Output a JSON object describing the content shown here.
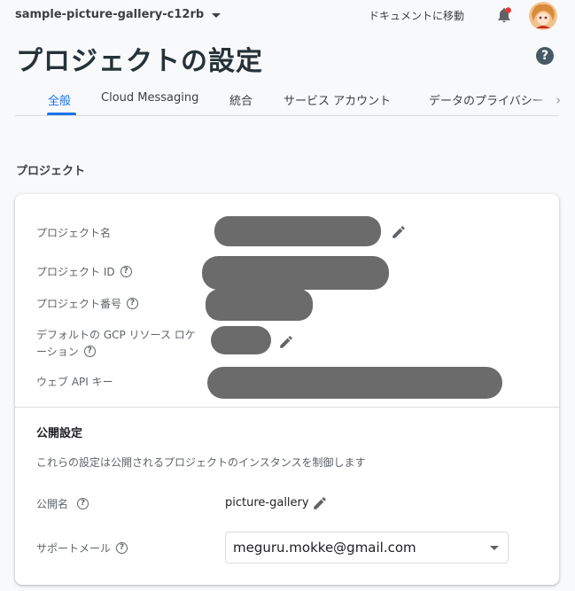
{
  "header": {
    "project_name": "sample-picture-gallery-c12rb",
    "docs_link": "ドキュメントに移動"
  },
  "page": {
    "title": "プロジェクトの設定"
  },
  "tabs": [
    {
      "label": "全般",
      "active": true
    },
    {
      "label": "Cloud Messaging",
      "active": false
    },
    {
      "label": "統合",
      "active": false
    },
    {
      "label": "サービス アカウント",
      "active": false
    },
    {
      "label": "データのプライバシー",
      "active": false
    }
  ],
  "project_section": {
    "label": "プロジェクト",
    "fields": {
      "name": "プロジェクト名",
      "id": "プロジェクト ID",
      "number": "プロジェクト番号",
      "location_line1": "デフォルトの GCP リソース ロケ",
      "location_line2": "ーション",
      "api_key": "ウェブ API キー"
    }
  },
  "public_settings": {
    "title": "公開設定",
    "description": "これらの設定は公開されるプロジェクトのインスタンスを制御します",
    "public_name_label": "公開名",
    "public_name_value": "picture-gallery",
    "support_email_label": "サポートメール",
    "support_email_value": "meguru.mokke@gmail.com"
  },
  "colors": {
    "accent": "#1a73e8",
    "redaction": "#6b6b6b",
    "notification_dot": "#e53935"
  },
  "icons": {
    "help": "?",
    "tab_scroll": "›"
  }
}
